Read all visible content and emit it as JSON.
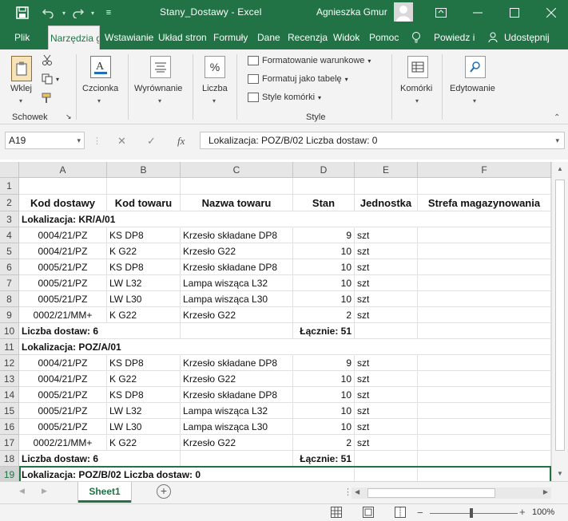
{
  "window": {
    "title": "Stany_Dostawy  -  Excel",
    "user": "Agnieszka Gmur"
  },
  "tabs": [
    {
      "label": "Plik"
    },
    {
      "label": "Narzędzia g"
    },
    {
      "label": "Wstawianie"
    },
    {
      "label": "Układ stron"
    },
    {
      "label": "Formuły"
    },
    {
      "label": "Dane"
    },
    {
      "label": "Recenzja"
    },
    {
      "label": "Widok"
    },
    {
      "label": "Pomoc"
    },
    {
      "label": "Powiedz i"
    },
    {
      "label": "Udostępnij"
    }
  ],
  "ribbon": {
    "paste": "Wklej",
    "clipboard_group": "Schowek",
    "font": "Czcionka",
    "alignment": "Wyrównanie",
    "number": "Liczba",
    "conditional": "Formatowanie warunkowe",
    "format_table": "Formatuj jako tabelę",
    "cell_styles": "Style komórki",
    "styles_group": "Style",
    "cells": "Komórki",
    "editing": "Edytowanie"
  },
  "formula_bar": {
    "name_box": "A19",
    "content": "Lokalizacja: POZ/B/02  Liczba dostaw: 0"
  },
  "columns": [
    "A",
    "B",
    "C",
    "D",
    "E",
    "F"
  ],
  "rows": [
    {
      "n": "1",
      "cells": [
        "",
        "",
        "",
        "",
        "",
        ""
      ]
    },
    {
      "n": "2",
      "cells": [
        "Kod dostawy",
        "Kod towaru",
        "Nazwa towaru",
        "Stan",
        "Jednostka",
        "Strefa magazynowania"
      ]
    },
    {
      "n": "3",
      "cells": [
        "Lokalizacja: KR/A/01",
        "",
        "",
        "",
        "",
        ""
      ]
    },
    {
      "n": "4",
      "cells": [
        "0004/21/PZ",
        "KS DP8",
        "Krzesło składane DP8",
        "9",
        "szt",
        ""
      ]
    },
    {
      "n": "5",
      "cells": [
        "0004/21/PZ",
        "K G22",
        "Krzesło G22",
        "10",
        "szt",
        ""
      ]
    },
    {
      "n": "6",
      "cells": [
        "0005/21/PZ",
        "KS DP8",
        "Krzesło składane DP8",
        "10",
        "szt",
        ""
      ]
    },
    {
      "n": "7",
      "cells": [
        "0005/21/PZ",
        "LW L32",
        "Lampa wisząca L32",
        "10",
        "szt",
        ""
      ]
    },
    {
      "n": "8",
      "cells": [
        "0005/21/PZ",
        "LW L30",
        "Lampa wisząca L30",
        "10",
        "szt",
        ""
      ]
    },
    {
      "n": "9",
      "cells": [
        "0002/21/MM+",
        "K G22",
        "Krzesło G22",
        "2",
        "szt",
        ""
      ]
    },
    {
      "n": "10",
      "cells": [
        "Liczba dostaw: 6",
        "",
        "",
        "Łącznie: 51",
        "",
        ""
      ]
    },
    {
      "n": "11",
      "cells": [
        "Lokalizacja: POZ/A/01",
        "",
        "",
        "",
        "",
        ""
      ]
    },
    {
      "n": "12",
      "cells": [
        "0004/21/PZ",
        "KS DP8",
        "Krzesło składane DP8",
        "9",
        "szt",
        ""
      ]
    },
    {
      "n": "13",
      "cells": [
        "0004/21/PZ",
        "K G22",
        "Krzesło G22",
        "10",
        "szt",
        ""
      ]
    },
    {
      "n": "14",
      "cells": [
        "0005/21/PZ",
        "KS DP8",
        "Krzesło składane DP8",
        "10",
        "szt",
        ""
      ]
    },
    {
      "n": "15",
      "cells": [
        "0005/21/PZ",
        "LW L32",
        "Lampa wisząca L32",
        "10",
        "szt",
        ""
      ]
    },
    {
      "n": "16",
      "cells": [
        "0005/21/PZ",
        "LW L30",
        "Lampa wisząca L30",
        "10",
        "szt",
        ""
      ]
    },
    {
      "n": "17",
      "cells": [
        "0002/21/MM+",
        "K G22",
        "Krzesło G22",
        "2",
        "szt",
        ""
      ]
    },
    {
      "n": "18",
      "cells": [
        "Liczba dostaw: 6",
        "",
        "",
        "Łącznie: 51",
        "",
        ""
      ]
    },
    {
      "n": "19",
      "cells": [
        "Lokalizacja: POZ/B/02  Liczba dostaw: 0",
        "",
        "",
        "",
        "",
        ""
      ]
    }
  ],
  "sheet_tab": "Sheet1",
  "zoom": "100%",
  "colors": {
    "accent": "#217346"
  }
}
